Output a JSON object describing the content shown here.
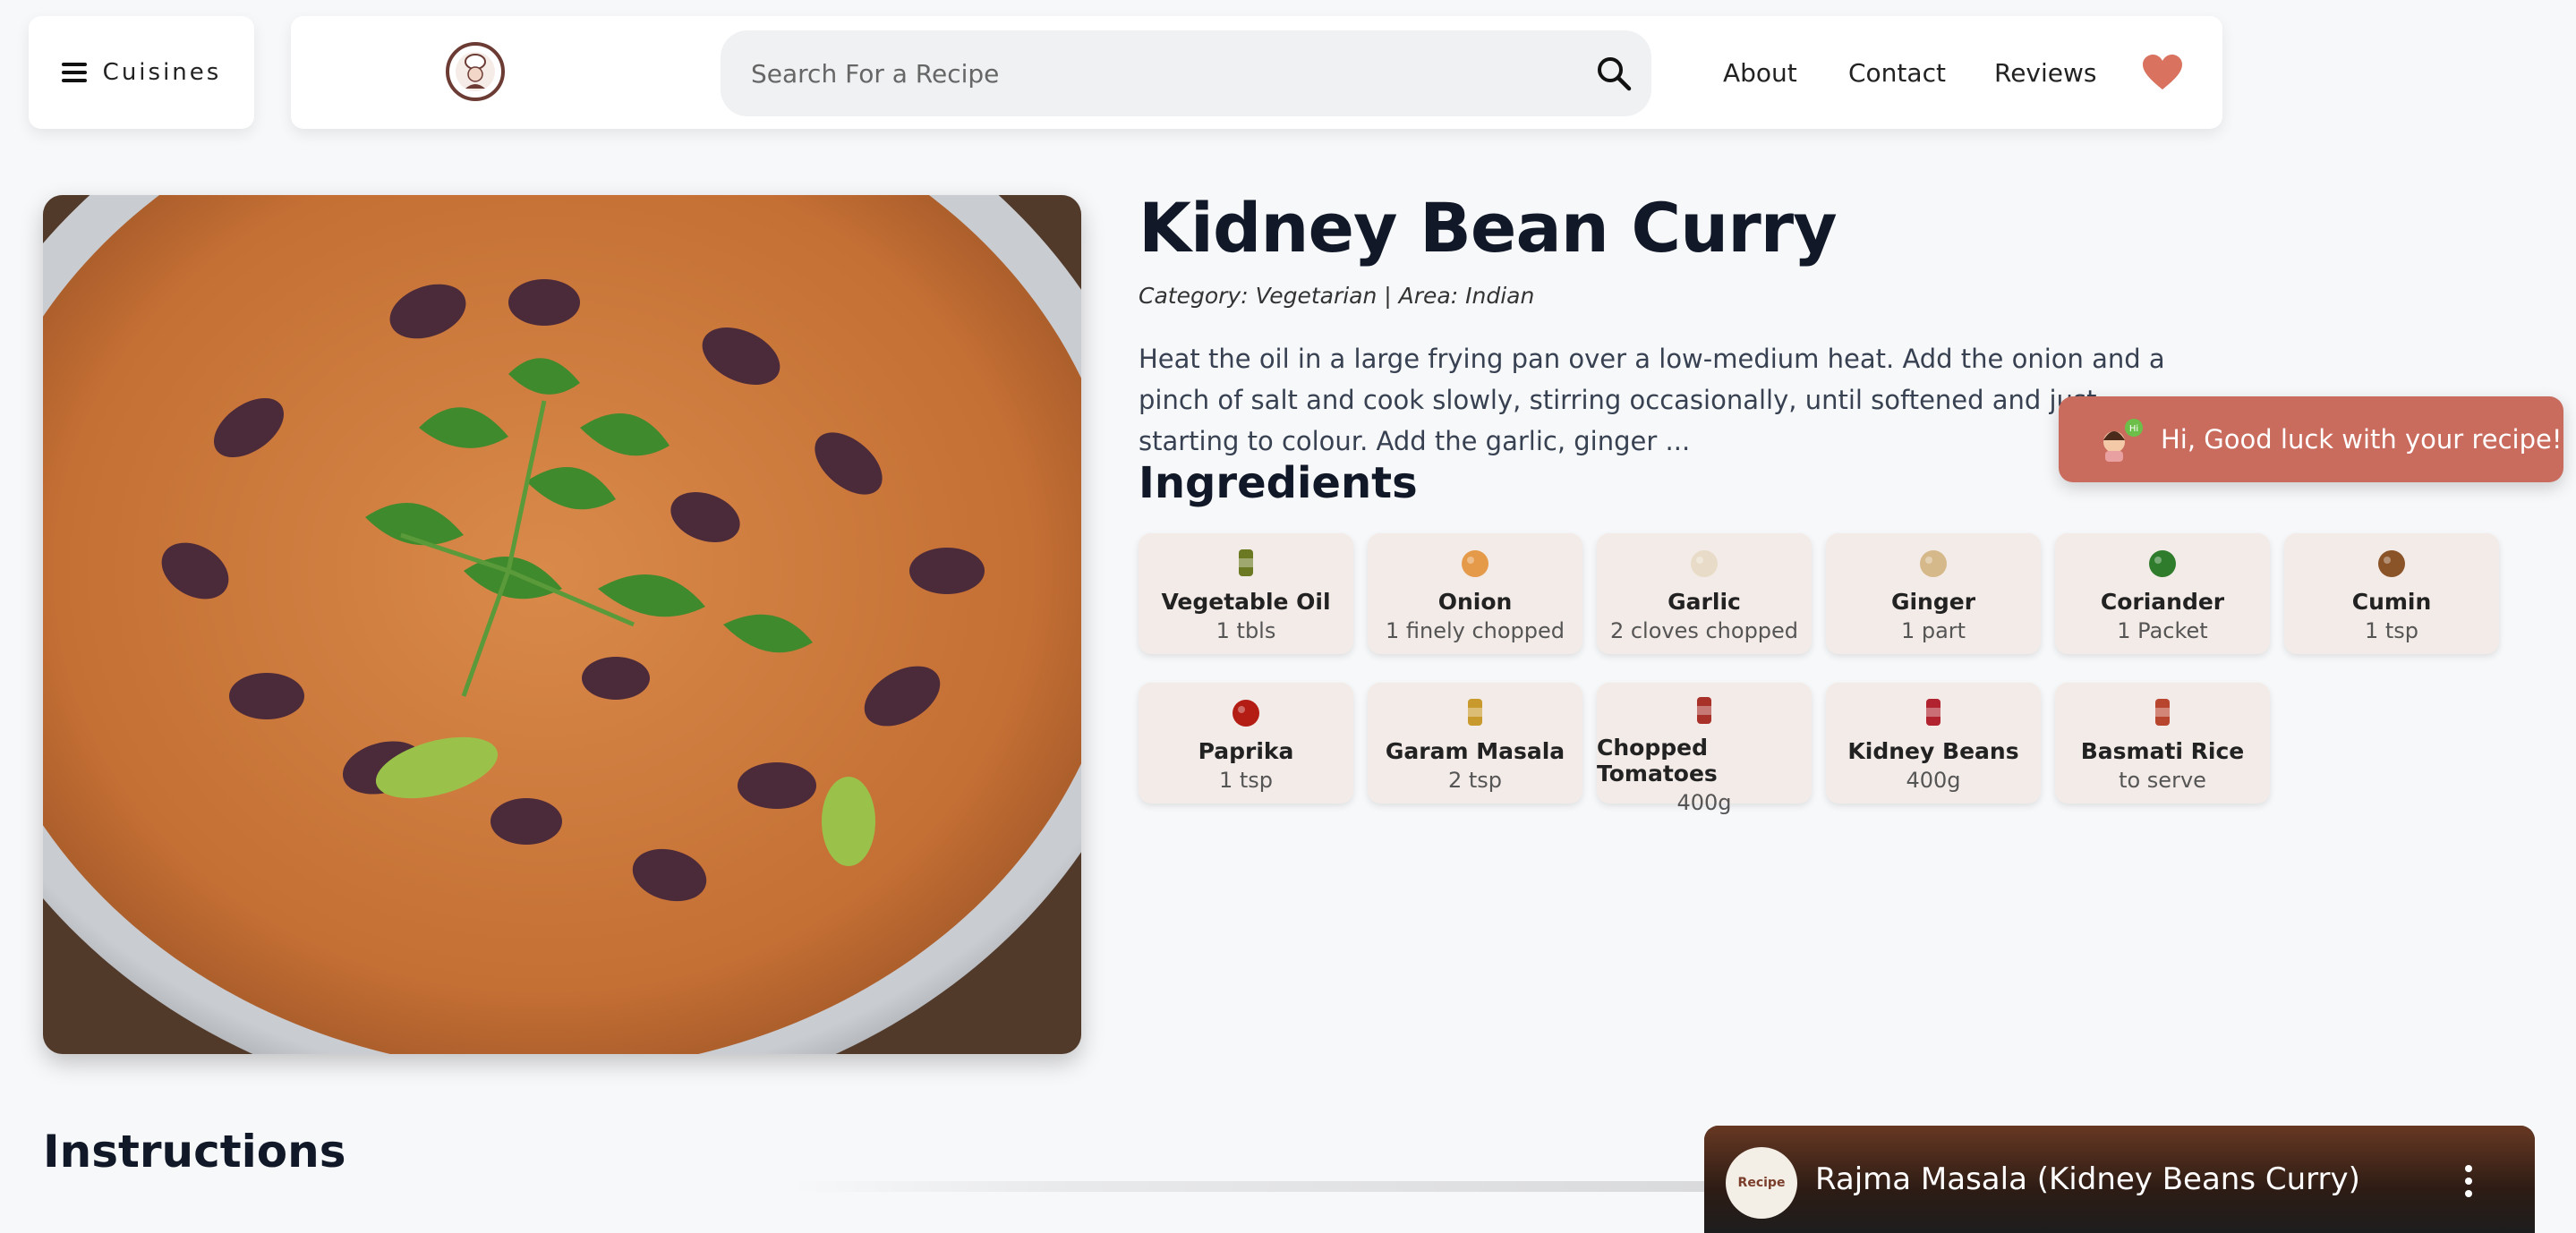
{
  "header": {
    "cuisines_label": "Cuisines",
    "search_placeholder": "Search For a Recipe",
    "nav": {
      "about": "About",
      "contact": "Contact",
      "reviews": "Reviews"
    },
    "icons": {
      "menu": "hamburger-icon",
      "logo": "chef-logo",
      "search": "search-icon",
      "favorites": "heart-icon"
    },
    "accent": "#d9735f"
  },
  "recipe": {
    "title": "Kidney Bean Curry",
    "meta": "Category: Vegetarian | Area: Indian",
    "description": "Heat the oil in a large frying pan over a low-medium heat. Add the onion and a pinch of salt and cook slowly, stirring occasionally, until softened and just starting to colour. Add the garlic, ginger ...",
    "ingredients_heading": "Ingredients",
    "ingredients": [
      {
        "name": "Vegetable Oil",
        "measure": "1 tbls",
        "icon": "oil-bottle-icon",
        "color": "#6b7a22"
      },
      {
        "name": "Onion",
        "measure": "1 finely chopped",
        "icon": "onion-icon",
        "color": "#e59a4a"
      },
      {
        "name": "Garlic",
        "measure": "2 cloves chopped",
        "icon": "garlic-icon",
        "color": "#e8dcc8"
      },
      {
        "name": "Ginger",
        "measure": "1 part",
        "icon": "ginger-icon",
        "color": "#d6b98a"
      },
      {
        "name": "Coriander",
        "measure": "1 Packet",
        "icon": "coriander-icon",
        "color": "#2f7d2c"
      },
      {
        "name": "Cumin",
        "measure": "1 tsp",
        "icon": "cumin-icon",
        "color": "#8a5428"
      },
      {
        "name": "Paprika",
        "measure": "1 tsp",
        "icon": "paprika-icon",
        "color": "#b31d14"
      },
      {
        "name": "Garam Masala",
        "measure": "2 tsp",
        "icon": "garam-masala-jar-icon",
        "color": "#c89a2d"
      },
      {
        "name": "Chopped Tomatoes",
        "measure": "400g",
        "icon": "tomato-can-icon",
        "color": "#a8322a"
      },
      {
        "name": "Kidney Beans",
        "measure": "400g",
        "icon": "bean-can-icon",
        "color": "#b0232f"
      },
      {
        "name": "Basmati Rice",
        "measure": "to serve",
        "icon": "rice-bag-icon",
        "color": "#b8452e"
      }
    ]
  },
  "toast": {
    "message": "Hi, Good luck with your recipe!",
    "icon": "chef-avatar-icon",
    "color": "#c96b5d"
  },
  "instructions": {
    "heading": "Instructions"
  },
  "video": {
    "title": "Rajma Masala (Kidney Beans Curry)",
    "channel_badge": "Recipe"
  }
}
